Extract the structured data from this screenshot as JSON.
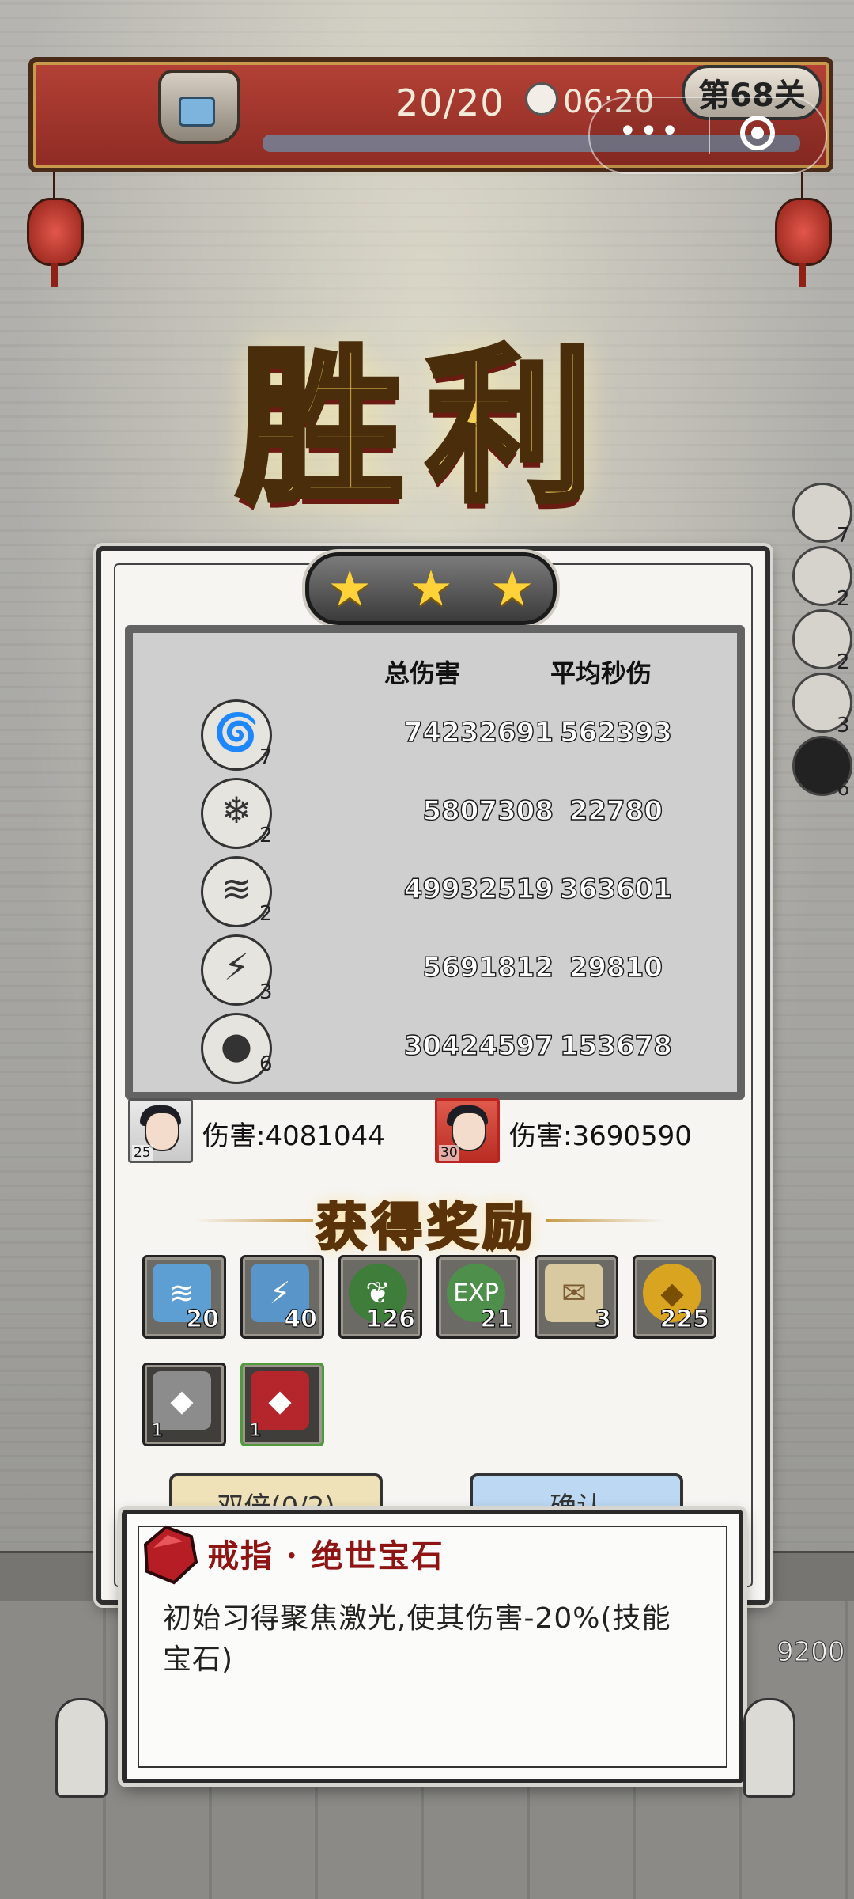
{
  "top_bar": {
    "progress": "20/20",
    "timer": "06:20",
    "level": "第68关"
  },
  "victory_title": "胜利",
  "stars": {
    "earned": 3,
    "total": 3
  },
  "stats": {
    "header_total": "总伤害",
    "header_avg": "平均秒伤",
    "rows": [
      {
        "skill_icon": "tornado-icon",
        "level": "7",
        "total": "74232691",
        "avg": "562393"
      },
      {
        "skill_icon": "ice-crystal-icon",
        "level": "2",
        "total": "5807308",
        "avg": "22780"
      },
      {
        "skill_icon": "drill-icon",
        "level": "2",
        "total": "49932519",
        "avg": "363601"
      },
      {
        "skill_icon": "lightning-icon",
        "level": "3",
        "total": "5691812",
        "avg": "29810"
      },
      {
        "skill_icon": "bomb-icon",
        "level": "6",
        "total": "30424597",
        "avg": "153678"
      }
    ]
  },
  "heroes": [
    {
      "avatar": "hero-avatar-icon",
      "level": "25",
      "damage": "伤害:4081044"
    },
    {
      "avatar": "hero-avatar-icon",
      "level": "30",
      "damage": "伤害:3690590"
    }
  ],
  "rewards_title": "获得奖励",
  "rewards": [
    {
      "icon": "drill-skill-book-icon",
      "count": "20",
      "color": "#5e9fd3"
    },
    {
      "icon": "lightning-skill-book-icon",
      "count": "40",
      "color": "#5a95c9"
    },
    {
      "icon": "leaf-gem-icon",
      "count": "126",
      "color": "#3e7d3a"
    },
    {
      "icon": "exp-icon",
      "count": "21",
      "color": "#4e8f4c"
    },
    {
      "icon": "scroll-icon",
      "count": "3",
      "color": "#d9c9a0"
    },
    {
      "icon": "gold-coin-icon",
      "count": "225",
      "color": "#d9a521"
    },
    {
      "icon": "silver-ore-icon",
      "count": "1",
      "color": "#8c8c8c"
    },
    {
      "icon": "red-gem-icon",
      "count": "1",
      "color": "#b5262c"
    }
  ],
  "buttons": {
    "double": "双倍(0/2)",
    "confirm": "确认"
  },
  "popup": {
    "title": "戒指 · 绝世宝石",
    "description": "初始习得聚焦激光,使其伤害-20%(技能宝石)"
  },
  "score": "9200",
  "side_skills": [
    {
      "icon": "tornado-icon",
      "level": "7"
    },
    {
      "icon": "ice-crystal-icon",
      "level": "2"
    },
    {
      "icon": "drill-icon",
      "level": "2"
    },
    {
      "icon": "lightning-icon",
      "level": "3"
    },
    {
      "icon": "bomb-icon",
      "level": "6"
    }
  ]
}
